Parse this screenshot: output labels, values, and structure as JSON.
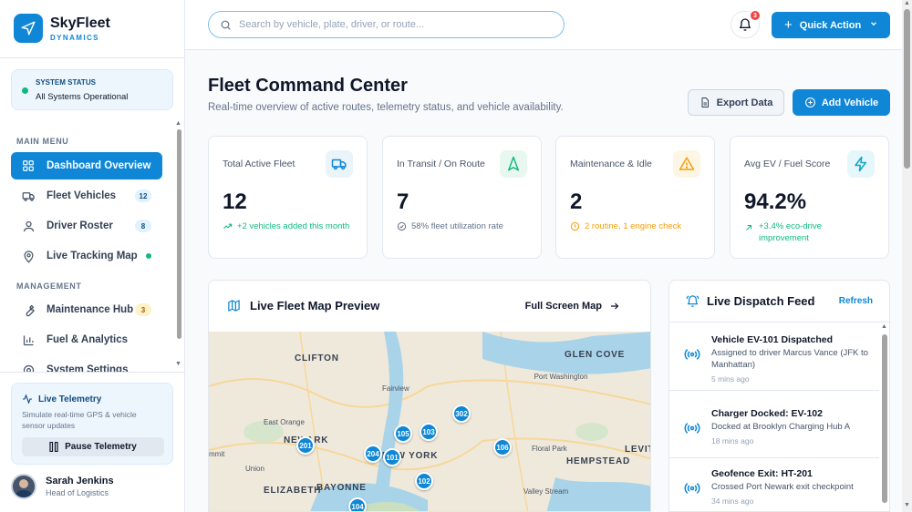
{
  "brand": {
    "name": "SkyFleet",
    "sub": "DYNAMICS"
  },
  "system_status": {
    "label": "SYSTEM STATUS",
    "value": "All Systems Operational"
  },
  "sidebar": {
    "sections": [
      {
        "label": "MAIN MENU"
      },
      {
        "label": "MANAGEMENT"
      }
    ],
    "items": [
      {
        "label": "Dashboard Overview",
        "icon": "grid-icon"
      },
      {
        "label": "Fleet Vehicles",
        "icon": "truck-icon",
        "badge": "12"
      },
      {
        "label": "Driver Roster",
        "icon": "users-icon",
        "badge": "8"
      },
      {
        "label": "Live Tracking Map",
        "icon": "map-pin-icon"
      },
      {
        "label": "Maintenance Hub",
        "icon": "wrench-icon",
        "badge": "3"
      },
      {
        "label": "Fuel & Analytics",
        "icon": "bar-chart-icon"
      },
      {
        "label": "System Settings",
        "icon": "gear-icon"
      }
    ]
  },
  "telemetry": {
    "title": "Live Telemetry",
    "desc": "Simulate real-time GPS & vehicle sensor updates",
    "button": "Pause Telemetry"
  },
  "user": {
    "name": "Sarah Jenkins",
    "role": "Head of Logistics"
  },
  "topbar": {
    "search_placeholder": "Search by vehicle, plate, driver, or route...",
    "notif_count": "3",
    "quick_action": "Quick Action"
  },
  "header": {
    "title": "Fleet Command Center",
    "subtitle": "Real-time overview of active routes, telemetry status, and vehicle availability.",
    "export_label": "Export Data",
    "add_label": "Add Vehicle"
  },
  "kpis": [
    {
      "label": "Total Active Fleet",
      "value": "12",
      "note": "+2 vehicles added this month",
      "icon": "truck-icon",
      "color": "#10b981"
    },
    {
      "label": "In Transit / On Route",
      "value": "7",
      "note": "58% fleet utilization rate",
      "icon": "navigation-icon",
      "color": "#64748b"
    },
    {
      "label": "Maintenance & Idle",
      "value": "2",
      "note": "2 routine, 1 engine check",
      "icon": "alert-triangle-icon",
      "color": "#f59e0b"
    },
    {
      "label": "Avg EV / Fuel Score",
      "value": "94.2%",
      "note": "+3.4% eco-drive improvement",
      "icon": "lightning-icon",
      "color": "#10b981"
    }
  ],
  "map": {
    "title": "Live Fleet Map Preview",
    "link": "Full Screen Map",
    "places": [
      "CLIFTON",
      "GLEN COVE",
      "Port Washington",
      "Fairview",
      "East Orange",
      "NEWARK",
      "NEW YORK",
      "Floral Park",
      "LEVITT",
      "HEMPSTEAD",
      "Union",
      "mmit",
      "ELIZABETH",
      "BAYONNE",
      "Valley Stream"
    ],
    "pins": [
      "302",
      "105",
      "103",
      "201",
      "204",
      "101",
      "106",
      "102",
      "104"
    ]
  },
  "feed": {
    "title": "Live Dispatch Feed",
    "refresh": "Refresh",
    "items": [
      {
        "title": "Vehicle EV-101 Dispatched",
        "desc": "Assigned to driver Marcus Vance (JFK to Manhattan)",
        "time": "5 mins ago"
      },
      {
        "title": "Charger Docked: EV-102",
        "desc": "Docked at Brooklyn Charging Hub A",
        "time": "18 mins ago"
      },
      {
        "title": "Geofence Exit: HT-201",
        "desc": "Crossed Port Newark exit checkpoint",
        "time": "34 mins ago"
      }
    ]
  },
  "colors": {
    "accent": "#0f87d6",
    "success": "#10b981",
    "warning": "#f59e0b",
    "danger": "#ef4444"
  }
}
